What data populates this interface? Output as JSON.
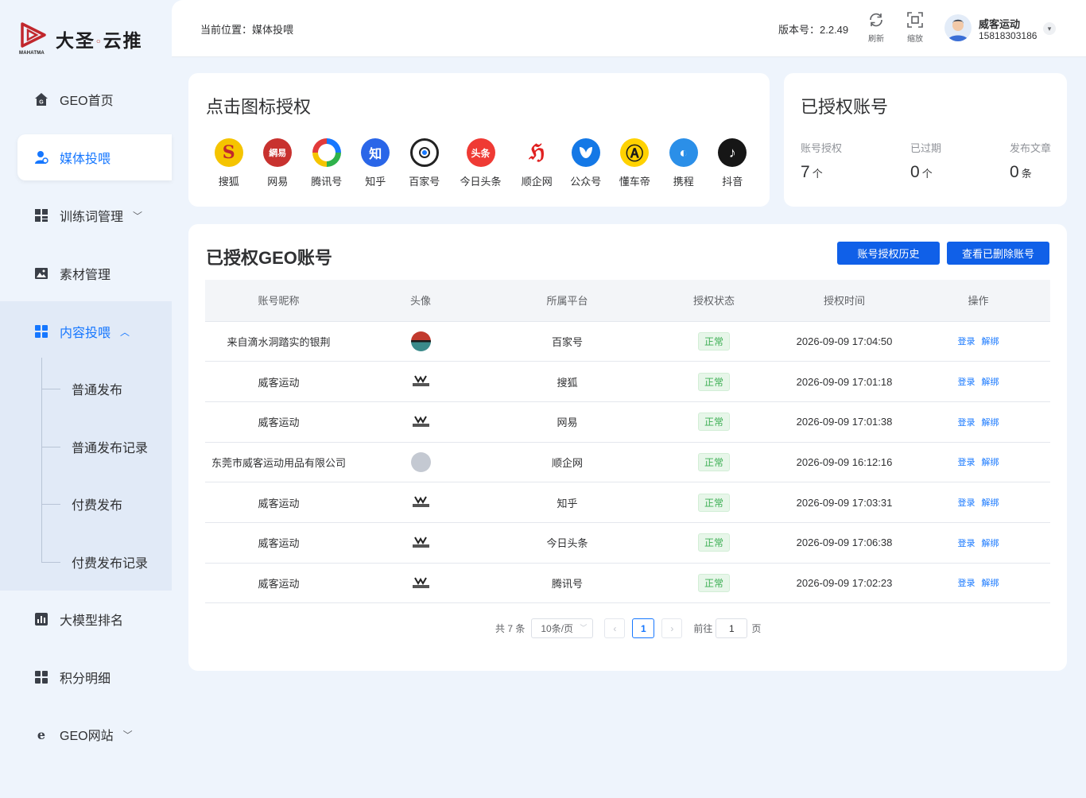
{
  "brand": {
    "name": "大圣",
    "name2": "云推",
    "sub": "MAHATMA"
  },
  "sidebar": {
    "items": [
      {
        "label": "GEO首页",
        "icon": "home-icon"
      },
      {
        "label": "媒体投喂",
        "icon": "user-icon"
      },
      {
        "label": "训练词管理",
        "icon": "grid-icon"
      },
      {
        "label": "素材管理",
        "icon": "image-icon"
      },
      {
        "label": "内容投喂",
        "icon": "grid-icon"
      },
      {
        "label": "大模型排名",
        "icon": "bar-chart-icon"
      },
      {
        "label": "积分明细",
        "icon": "grid-icon"
      },
      {
        "label": "GEO网站",
        "icon": "browser-icon"
      }
    ],
    "submenu": [
      "普通发布",
      "普通发布记录",
      "付费发布",
      "付费发布记录"
    ]
  },
  "header": {
    "breadcrumb": "当前位置：媒体投喂",
    "version": "版本号：2.2.49",
    "refresh_label": "刷新",
    "zoom_label": "缩放",
    "user_name": "威客运动",
    "user_phone": "15818303186"
  },
  "authorize": {
    "title": "点击图标授权",
    "platforms": [
      {
        "label": "搜狐",
        "glyph": "S",
        "color": "#f5c400"
      },
      {
        "label": "网易",
        "glyph": "網易",
        "color": "#c8322f"
      },
      {
        "label": "腾讯号",
        "glyph": "",
        "color": "#ffffff"
      },
      {
        "label": "知乎",
        "glyph": "知",
        "color": "#2a66e8"
      },
      {
        "label": "百家号",
        "glyph": "",
        "color": "#ffffff"
      },
      {
        "label": "今日头条",
        "glyph": "头条",
        "color": "#ef3a34"
      },
      {
        "label": "顺企网",
        "glyph": "",
        "color": "#ffffff"
      },
      {
        "label": "公众号",
        "glyph": "",
        "color": "#1478e6"
      },
      {
        "label": "懂车帝",
        "glyph": "A",
        "color": "#ffd200"
      },
      {
        "label": "携程",
        "glyph": "",
        "color": "#2b8fe8"
      },
      {
        "label": "抖音",
        "glyph": "♪",
        "color": "#161616"
      }
    ]
  },
  "authorized": {
    "title": "已授权账号",
    "stats": [
      {
        "label": "账号授权",
        "value": "7",
        "unit": "个"
      },
      {
        "label": "已过期",
        "value": "0",
        "unit": "个"
      },
      {
        "label": "发布文章",
        "value": "0",
        "unit": "条"
      }
    ]
  },
  "geo": {
    "title": "已授权GEO账号",
    "history_button": "账号授权历史",
    "deleted_button": "查看已删除账号",
    "columns": [
      "账号昵称",
      "头像",
      "所属平台",
      "授权状态",
      "授权时间",
      "操作"
    ],
    "rows": [
      {
        "nickname": "来自滴水洞踏实的银荆",
        "avatar": "landscape",
        "platform": "百家号",
        "status": "正常",
        "time": "2026-09-09 17:04:50"
      },
      {
        "nickname": "威客运动",
        "avatar": "brand-logo",
        "platform": "搜狐",
        "status": "正常",
        "time": "2026-09-09 17:01:18"
      },
      {
        "nickname": "威客运动",
        "avatar": "brand-logo",
        "platform": "网易",
        "status": "正常",
        "time": "2026-09-09 17:01:38"
      },
      {
        "nickname": "东莞市威客运动用品有限公司",
        "avatar": "grey",
        "platform": "顺企网",
        "status": "正常",
        "time": "2026-09-09 16:12:16"
      },
      {
        "nickname": "威客运动",
        "avatar": "brand-logo",
        "platform": "知乎",
        "status": "正常",
        "time": "2026-09-09 17:03:31"
      },
      {
        "nickname": "威客运动",
        "avatar": "brand-logo",
        "platform": "今日头条",
        "status": "正常",
        "time": "2026-09-09 17:06:38"
      },
      {
        "nickname": "威客运动",
        "avatar": "brand-logo",
        "platform": "腾讯号",
        "status": "正常",
        "time": "2026-09-09 17:02:23"
      }
    ],
    "ops": {
      "login": "登录",
      "unbind": "解绑"
    },
    "pagination": {
      "total": "共 7 条",
      "page_size": "10条/页",
      "current": "1",
      "goto_label": "前往",
      "goto_value": "1",
      "page_suffix": "页"
    }
  }
}
